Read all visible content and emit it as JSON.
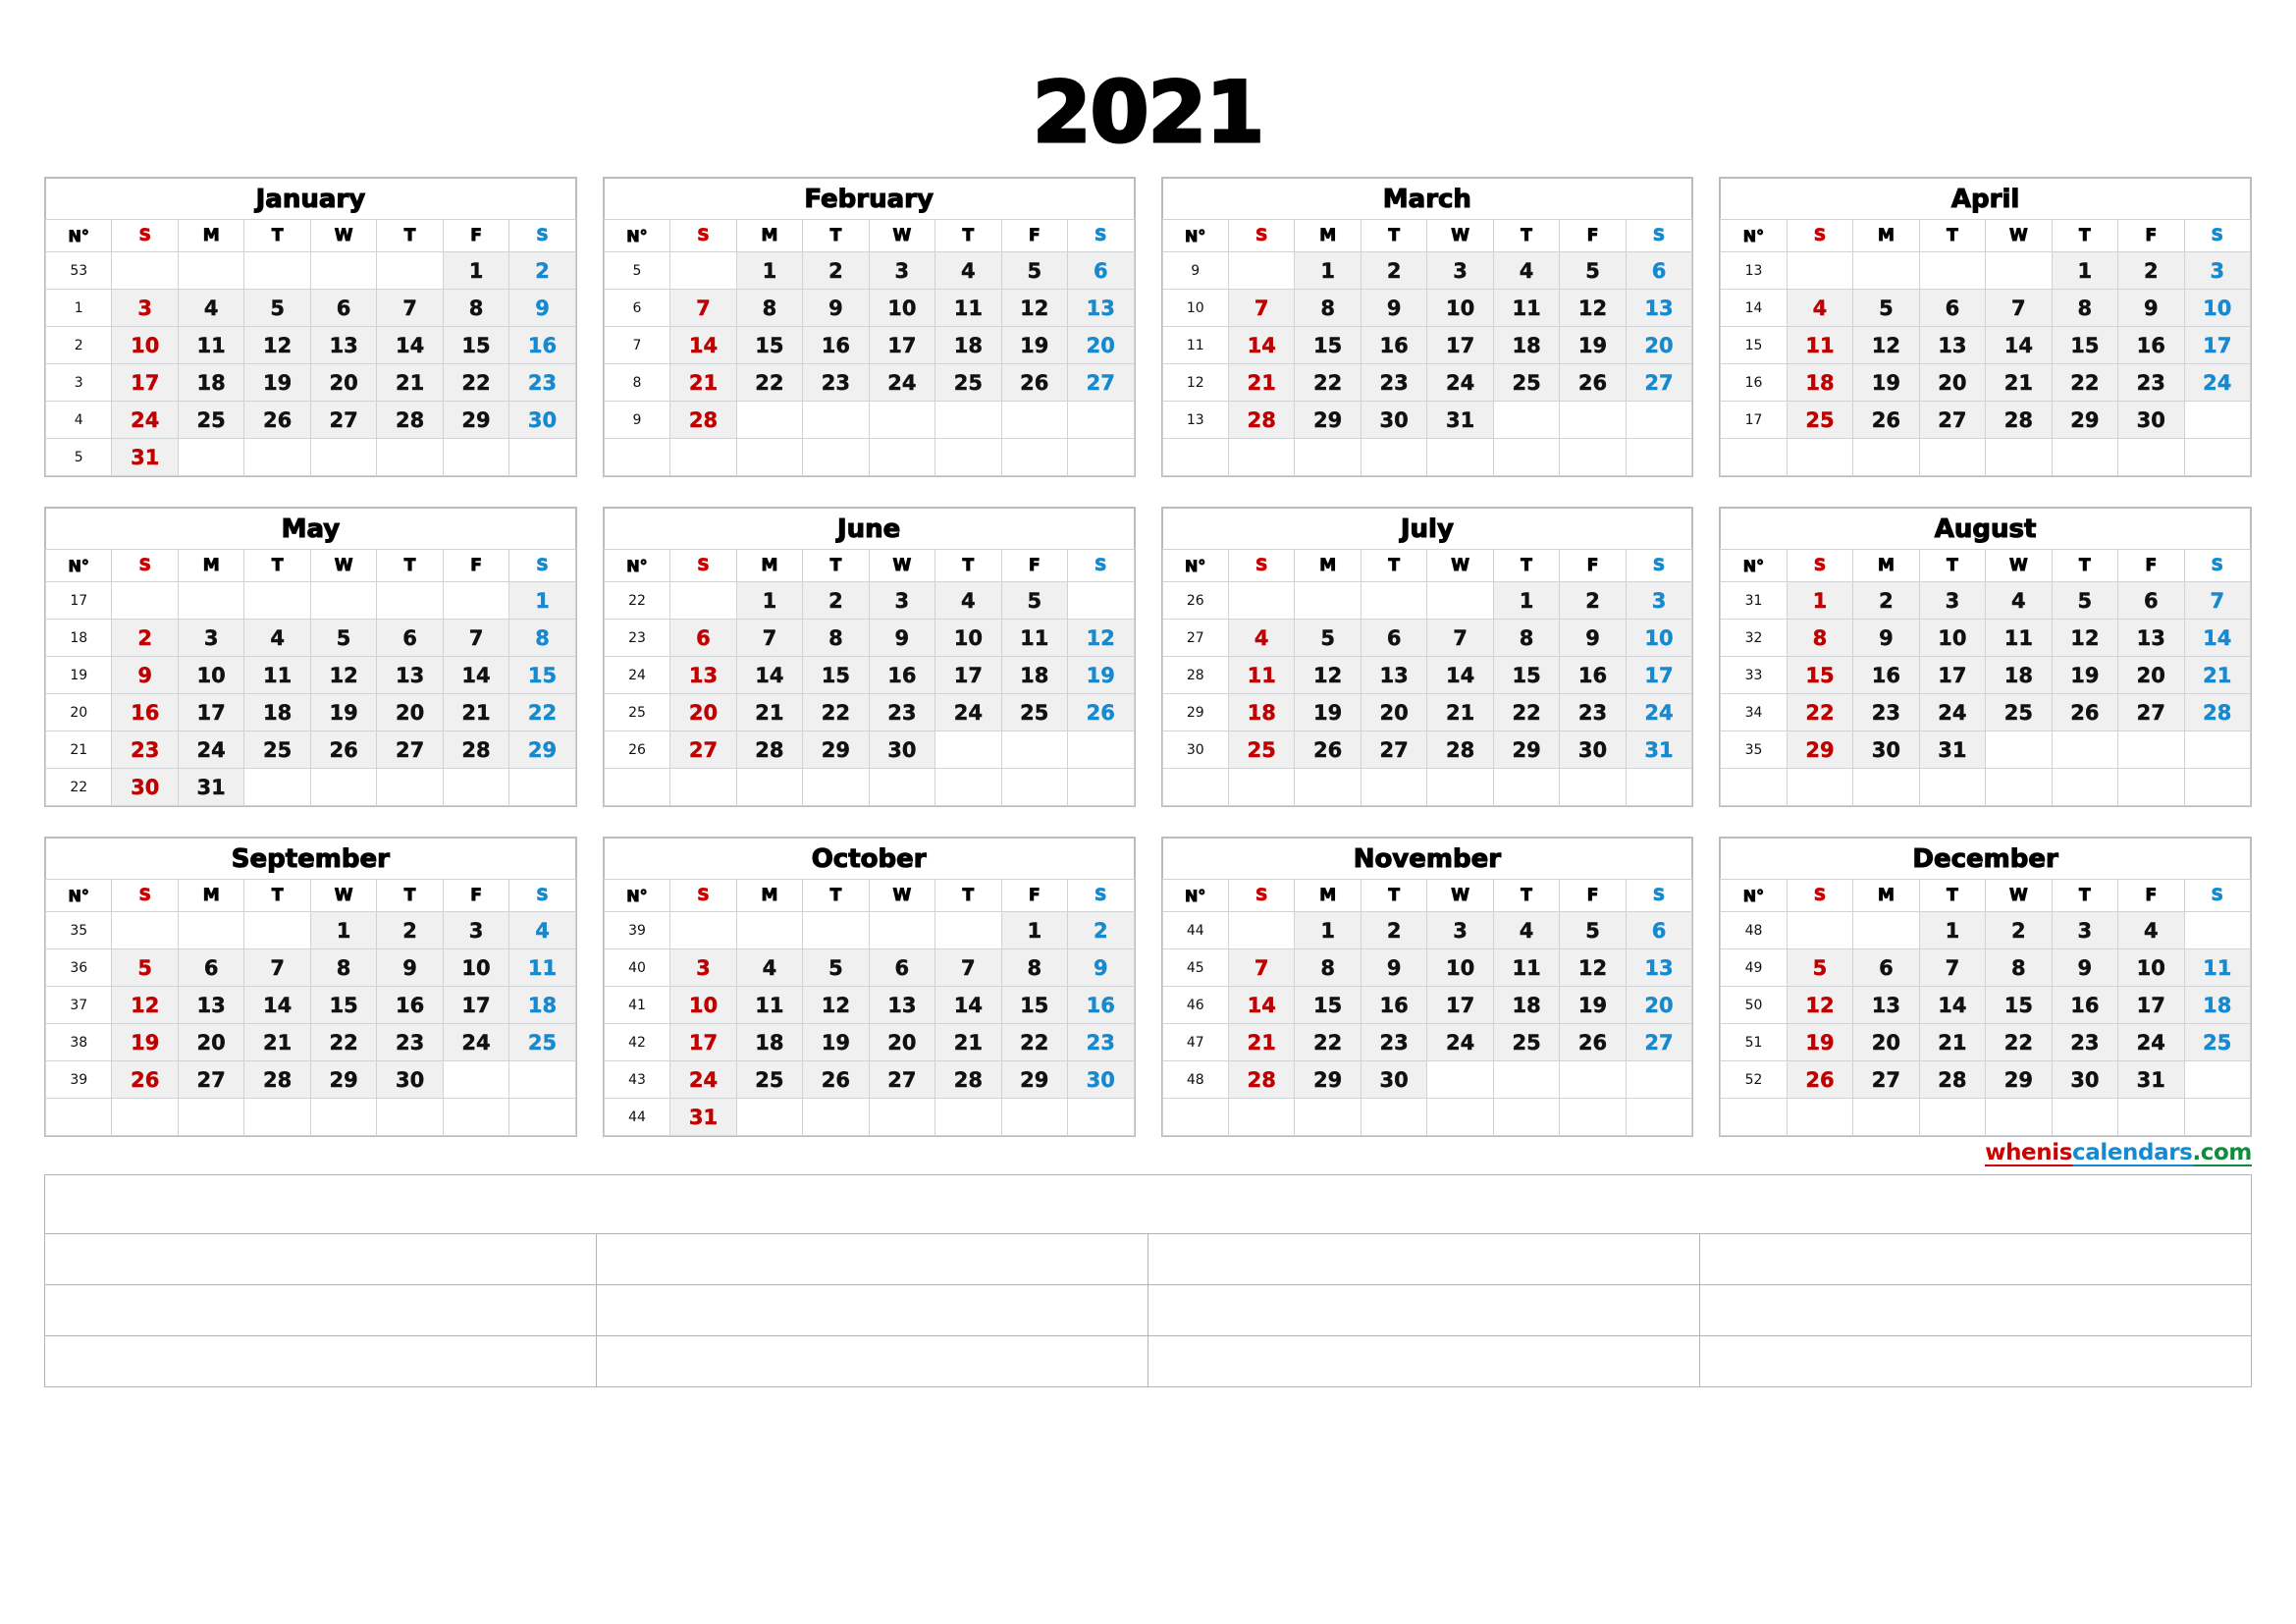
{
  "title": "2021",
  "watermark": {
    "part1": "whenis",
    "part2": "calendars",
    "part3": ".com"
  },
  "weekday_headers": {
    "weeknum": "N°",
    "sun": "S",
    "mon": "M",
    "tue": "T",
    "wed": "W",
    "thu": "T",
    "fri": "F",
    "sat": "S"
  },
  "colors": {
    "sunday": "#cc0000",
    "saturday": "#1789ce",
    "day_text": "#111111",
    "cell_fill": "#f0f0f0",
    "grid_line": "#cfd2d6",
    "watermark_red": "#cc0000",
    "watermark_blue": "#1789ce",
    "watermark_green": "#118c3c"
  },
  "notes": {
    "rows": 4,
    "first_row_columns": 1,
    "other_row_columns": 4
  },
  "months": [
    {
      "name": "January",
      "weeks": [
        {
          "num": "53",
          "days": [
            "",
            "",
            "",
            "",
            "",
            "1",
            "2"
          ]
        },
        {
          "num": "1",
          "days": [
            "3",
            "4",
            "5",
            "6",
            "7",
            "8",
            "9"
          ]
        },
        {
          "num": "2",
          "days": [
            "10",
            "11",
            "12",
            "13",
            "14",
            "15",
            "16"
          ]
        },
        {
          "num": "3",
          "days": [
            "17",
            "18",
            "19",
            "20",
            "21",
            "22",
            "23"
          ]
        },
        {
          "num": "4",
          "days": [
            "24",
            "25",
            "26",
            "27",
            "28",
            "29",
            "30"
          ]
        },
        {
          "num": "5",
          "days": [
            "31",
            "",
            "",
            "",
            "",
            "",
            ""
          ]
        }
      ]
    },
    {
      "name": "February",
      "weeks": [
        {
          "num": "5",
          "days": [
            "",
            "1",
            "2",
            "3",
            "4",
            "5",
            "6"
          ]
        },
        {
          "num": "6",
          "days": [
            "7",
            "8",
            "9",
            "10",
            "11",
            "12",
            "13"
          ]
        },
        {
          "num": "7",
          "days": [
            "14",
            "15",
            "16",
            "17",
            "18",
            "19",
            "20"
          ]
        },
        {
          "num": "8",
          "days": [
            "21",
            "22",
            "23",
            "24",
            "25",
            "26",
            "27"
          ]
        },
        {
          "num": "9",
          "days": [
            "28",
            "",
            "",
            "",
            "",
            "",
            ""
          ]
        },
        {
          "num": "",
          "days": [
            "",
            "",
            "",
            "",
            "",
            "",
            ""
          ]
        }
      ]
    },
    {
      "name": "March",
      "weeks": [
        {
          "num": "9",
          "days": [
            "",
            "1",
            "2",
            "3",
            "4",
            "5",
            "6"
          ]
        },
        {
          "num": "10",
          "days": [
            "7",
            "8",
            "9",
            "10",
            "11",
            "12",
            "13"
          ]
        },
        {
          "num": "11",
          "days": [
            "14",
            "15",
            "16",
            "17",
            "18",
            "19",
            "20"
          ]
        },
        {
          "num": "12",
          "days": [
            "21",
            "22",
            "23",
            "24",
            "25",
            "26",
            "27"
          ]
        },
        {
          "num": "13",
          "days": [
            "28",
            "29",
            "30",
            "31",
            "",
            "",
            ""
          ]
        },
        {
          "num": "",
          "days": [
            "",
            "",
            "",
            "",
            "",
            "",
            ""
          ]
        }
      ]
    },
    {
      "name": "April",
      "weeks": [
        {
          "num": "13",
          "days": [
            "",
            "",
            "",
            "",
            "1",
            "2",
            "3"
          ]
        },
        {
          "num": "14",
          "days": [
            "4",
            "5",
            "6",
            "7",
            "8",
            "9",
            "10"
          ]
        },
        {
          "num": "15",
          "days": [
            "11",
            "12",
            "13",
            "14",
            "15",
            "16",
            "17"
          ]
        },
        {
          "num": "16",
          "days": [
            "18",
            "19",
            "20",
            "21",
            "22",
            "23",
            "24"
          ]
        },
        {
          "num": "17",
          "days": [
            "25",
            "26",
            "27",
            "28",
            "29",
            "30",
            ""
          ]
        },
        {
          "num": "",
          "days": [
            "",
            "",
            "",
            "",
            "",
            "",
            ""
          ]
        }
      ]
    },
    {
      "name": "May",
      "weeks": [
        {
          "num": "17",
          "days": [
            "",
            "",
            "",
            "",
            "",
            "",
            "1"
          ]
        },
        {
          "num": "18",
          "days": [
            "2",
            "3",
            "4",
            "5",
            "6",
            "7",
            "8"
          ]
        },
        {
          "num": "19",
          "days": [
            "9",
            "10",
            "11",
            "12",
            "13",
            "14",
            "15"
          ]
        },
        {
          "num": "20",
          "days": [
            "16",
            "17",
            "18",
            "19",
            "20",
            "21",
            "22"
          ]
        },
        {
          "num": "21",
          "days": [
            "23",
            "24",
            "25",
            "26",
            "27",
            "28",
            "29"
          ]
        },
        {
          "num": "22",
          "days": [
            "30",
            "31",
            "",
            "",
            "",
            "",
            ""
          ]
        }
      ]
    },
    {
      "name": "June",
      "weeks": [
        {
          "num": "22",
          "days": [
            "",
            "1",
            "2",
            "3",
            "4",
            "5",
            ""
          ]
        },
        {
          "num": "23",
          "days": [
            "6",
            "7",
            "8",
            "9",
            "10",
            "11",
            "12"
          ]
        },
        {
          "num": "24",
          "days": [
            "13",
            "14",
            "15",
            "16",
            "17",
            "18",
            "19"
          ]
        },
        {
          "num": "25",
          "days": [
            "20",
            "21",
            "22",
            "23",
            "24",
            "25",
            "26"
          ]
        },
        {
          "num": "26",
          "days": [
            "27",
            "28",
            "29",
            "30",
            "",
            "",
            ""
          ]
        },
        {
          "num": "",
          "days": [
            "",
            "",
            "",
            "",
            "",
            "",
            ""
          ]
        }
      ]
    },
    {
      "name": "July",
      "weeks": [
        {
          "num": "26",
          "days": [
            "",
            "",
            "",
            "",
            "1",
            "2",
            "3"
          ]
        },
        {
          "num": "27",
          "days": [
            "4",
            "5",
            "6",
            "7",
            "8",
            "9",
            "10"
          ]
        },
        {
          "num": "28",
          "days": [
            "11",
            "12",
            "13",
            "14",
            "15",
            "16",
            "17"
          ]
        },
        {
          "num": "29",
          "days": [
            "18",
            "19",
            "20",
            "21",
            "22",
            "23",
            "24"
          ]
        },
        {
          "num": "30",
          "days": [
            "25",
            "26",
            "27",
            "28",
            "29",
            "30",
            "31"
          ]
        },
        {
          "num": "",
          "days": [
            "",
            "",
            "",
            "",
            "",
            "",
            ""
          ]
        }
      ]
    },
    {
      "name": "August",
      "weeks": [
        {
          "num": "31",
          "days": [
            "1",
            "2",
            "3",
            "4",
            "5",
            "6",
            "7"
          ]
        },
        {
          "num": "32",
          "days": [
            "8",
            "9",
            "10",
            "11",
            "12",
            "13",
            "14"
          ]
        },
        {
          "num": "33",
          "days": [
            "15",
            "16",
            "17",
            "18",
            "19",
            "20",
            "21"
          ]
        },
        {
          "num": "34",
          "days": [
            "22",
            "23",
            "24",
            "25",
            "26",
            "27",
            "28"
          ]
        },
        {
          "num": "35",
          "days": [
            "29",
            "30",
            "31",
            "",
            "",
            "",
            ""
          ]
        },
        {
          "num": "",
          "days": [
            "",
            "",
            "",
            "",
            "",
            "",
            ""
          ]
        }
      ]
    },
    {
      "name": "September",
      "weeks": [
        {
          "num": "35",
          "days": [
            "",
            "",
            "",
            "1",
            "2",
            "3",
            "4"
          ]
        },
        {
          "num": "36",
          "days": [
            "5",
            "6",
            "7",
            "8",
            "9",
            "10",
            "11"
          ]
        },
        {
          "num": "37",
          "days": [
            "12",
            "13",
            "14",
            "15",
            "16",
            "17",
            "18"
          ]
        },
        {
          "num": "38",
          "days": [
            "19",
            "20",
            "21",
            "22",
            "23",
            "24",
            "25"
          ]
        },
        {
          "num": "39",
          "days": [
            "26",
            "27",
            "28",
            "29",
            "30",
            "",
            ""
          ]
        },
        {
          "num": "",
          "days": [
            "",
            "",
            "",
            "",
            "",
            "",
            ""
          ]
        }
      ]
    },
    {
      "name": "October",
      "weeks": [
        {
          "num": "39",
          "days": [
            "",
            "",
            "",
            "",
            "",
            "1",
            "2"
          ]
        },
        {
          "num": "40",
          "days": [
            "3",
            "4",
            "5",
            "6",
            "7",
            "8",
            "9"
          ]
        },
        {
          "num": "41",
          "days": [
            "10",
            "11",
            "12",
            "13",
            "14",
            "15",
            "16"
          ]
        },
        {
          "num": "42",
          "days": [
            "17",
            "18",
            "19",
            "20",
            "21",
            "22",
            "23"
          ]
        },
        {
          "num": "43",
          "days": [
            "24",
            "25",
            "26",
            "27",
            "28",
            "29",
            "30"
          ]
        },
        {
          "num": "44",
          "days": [
            "31",
            "",
            "",
            "",
            "",
            "",
            ""
          ]
        }
      ]
    },
    {
      "name": "November",
      "weeks": [
        {
          "num": "44",
          "days": [
            "",
            "1",
            "2",
            "3",
            "4",
            "5",
            "6"
          ]
        },
        {
          "num": "45",
          "days": [
            "7",
            "8",
            "9",
            "10",
            "11",
            "12",
            "13"
          ]
        },
        {
          "num": "46",
          "days": [
            "14",
            "15",
            "16",
            "17",
            "18",
            "19",
            "20"
          ]
        },
        {
          "num": "47",
          "days": [
            "21",
            "22",
            "23",
            "24",
            "25",
            "26",
            "27"
          ]
        },
        {
          "num": "48",
          "days": [
            "28",
            "29",
            "30",
            "",
            "",
            "",
            ""
          ]
        },
        {
          "num": "",
          "days": [
            "",
            "",
            "",
            "",
            "",
            "",
            ""
          ]
        }
      ]
    },
    {
      "name": "December",
      "weeks": [
        {
          "num": "48",
          "days": [
            "",
            "",
            "1",
            "2",
            "3",
            "4",
            ""
          ]
        },
        {
          "num": "49",
          "days": [
            "5",
            "6",
            "7",
            "8",
            "9",
            "10",
            "11"
          ]
        },
        {
          "num": "50",
          "days": [
            "12",
            "13",
            "14",
            "15",
            "16",
            "17",
            "18"
          ]
        },
        {
          "num": "51",
          "days": [
            "19",
            "20",
            "21",
            "22",
            "23",
            "24",
            "25"
          ]
        },
        {
          "num": "52",
          "days": [
            "26",
            "27",
            "28",
            "29",
            "30",
            "31",
            ""
          ]
        },
        {
          "num": "",
          "days": [
            "",
            "",
            "",
            "",
            "",
            "",
            ""
          ]
        }
      ]
    }
  ]
}
